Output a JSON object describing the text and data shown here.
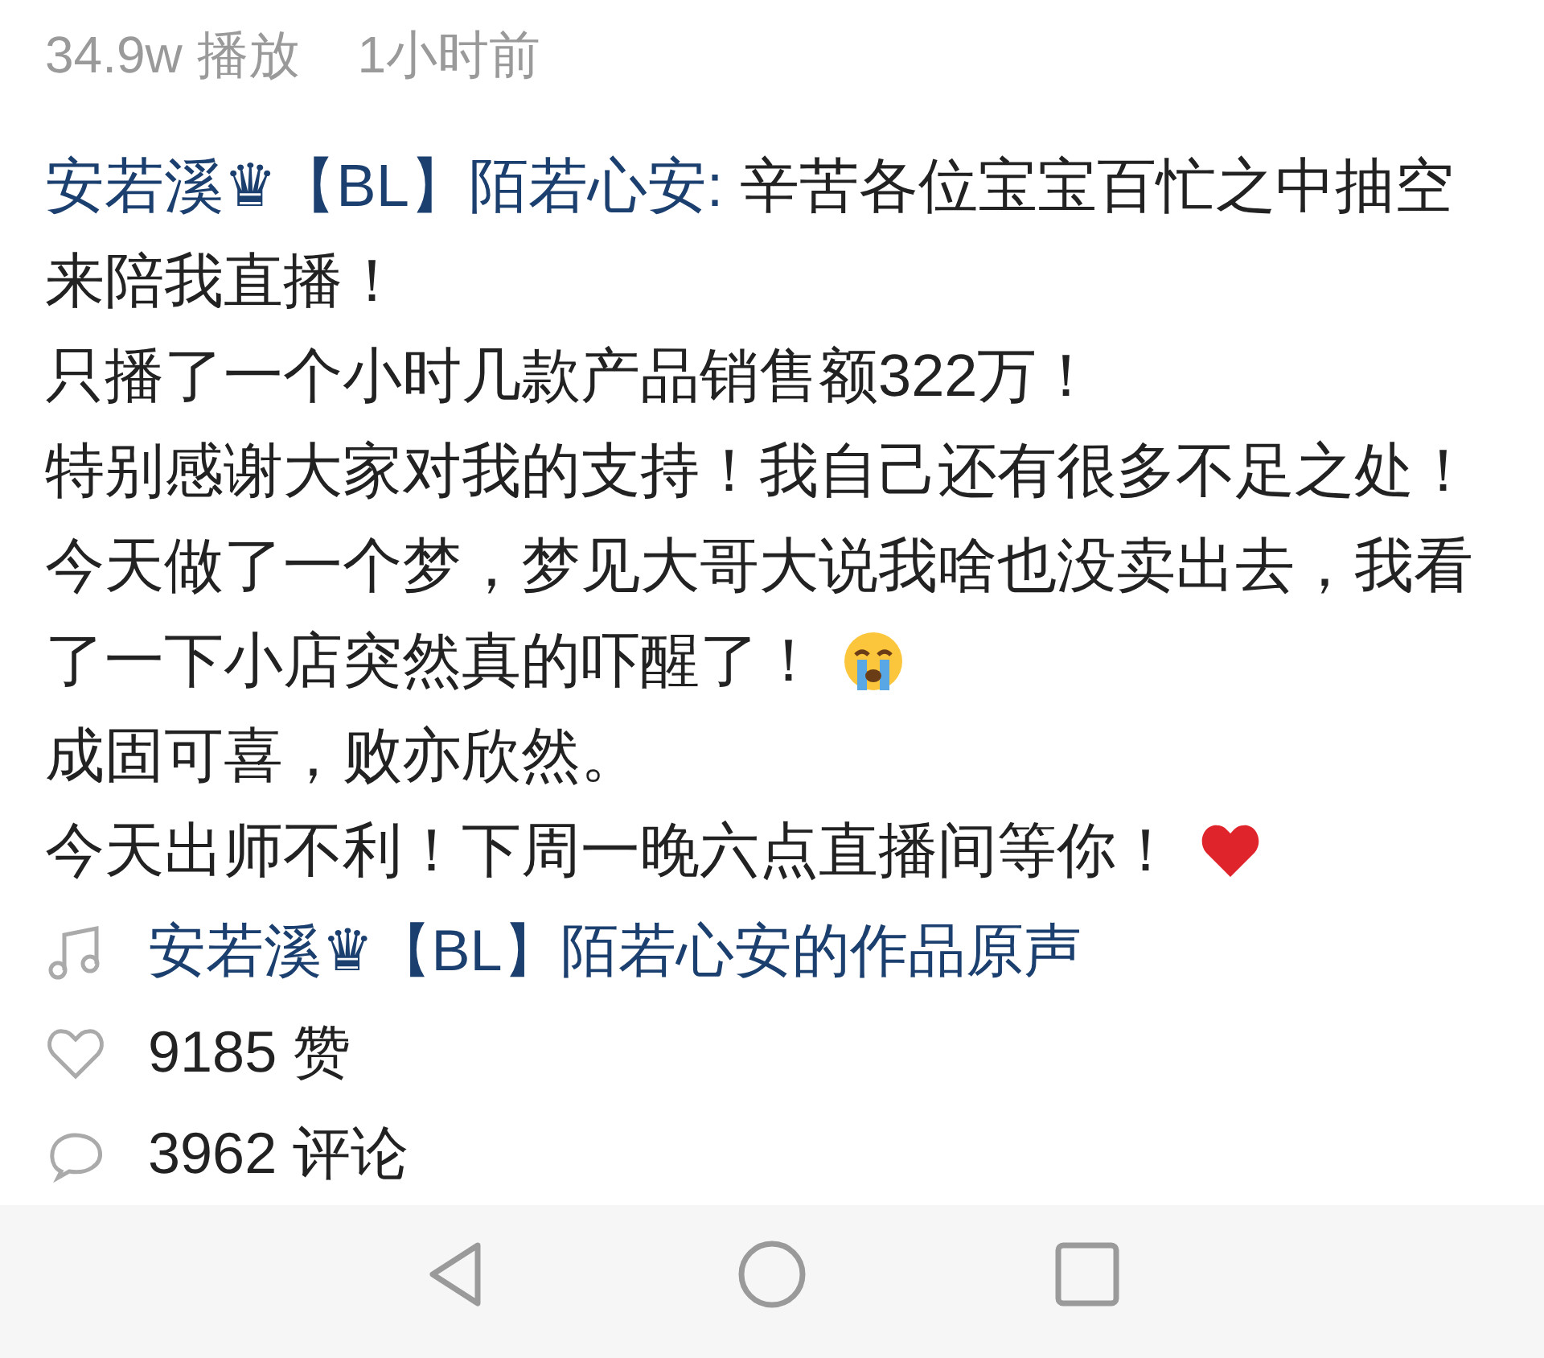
{
  "meta": {
    "plays": "34.9w 播放",
    "time": "1小时前"
  },
  "post": {
    "lines": [
      {
        "author": "安若溪♛【BL】陌若心安:",
        "text": "辛苦各位宝宝百忙之中抽空"
      },
      {
        "text": "来陪我直播！"
      },
      {
        "text": "只播了一个小时几款产品销售额322万！"
      },
      {
        "text": "特别感谢大家对我的支持！我自己还有很多不足之处！"
      },
      {
        "text": "今天做了一个梦，梦见大哥大说我啥也没卖出去，我看"
      },
      {
        "text": "了一下小店突然真的吓醒了！",
        "emoji": {
          "kind": "crying"
        }
      },
      {
        "text": "成固可喜，败亦欣然。"
      },
      {
        "text": "今天出师不利！下周一晚六点直播间等你！",
        "emoji": {
          "kind": "heart"
        }
      }
    ]
  },
  "sound": {
    "label": "安若溪♛【BL】陌若心安的作品原声"
  },
  "likes": {
    "label": "9185 赞"
  },
  "comments": {
    "label": "3962 评论"
  }
}
